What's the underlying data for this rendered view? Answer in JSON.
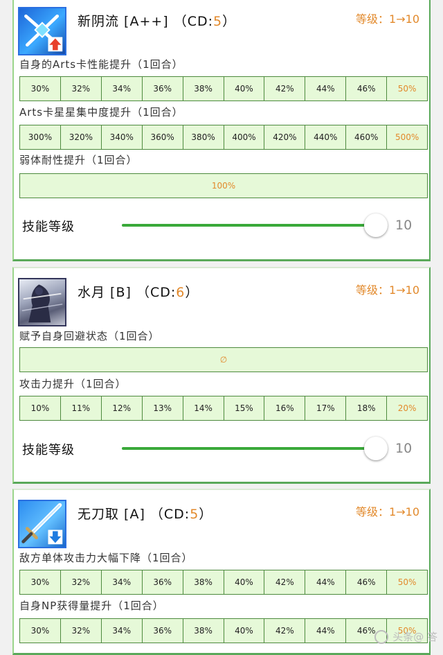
{
  "skills": [
    {
      "icon": "crossed-swords-buff-icon",
      "name": "新阴流 [A++] （CD:",
      "cd": "5",
      "cd_close": "）",
      "level_range": "等级：1→10",
      "effects": [
        {
          "label": "自身的Arts卡性能提升（1回合）",
          "values": [
            "30%",
            "32%",
            "34%",
            "36%",
            "38%",
            "40%",
            "42%",
            "44%",
            "46%",
            "50%"
          ]
        },
        {
          "label": "Arts卡星星集中度提升（1回合）",
          "values": [
            "300%",
            "320%",
            "340%",
            "360%",
            "380%",
            "400%",
            "420%",
            "440%",
            "460%",
            "500%"
          ]
        },
        {
          "label": "弱体耐性提升（1回合）",
          "single": "100%"
        }
      ],
      "level_label": "技能等级",
      "level_value": "10",
      "level_fraction": 1.0
    },
    {
      "icon": "samurai-portrait-icon",
      "name": "水月 [B] （CD:",
      "cd": "6",
      "cd_close": "）",
      "level_range": "等级：1→10",
      "effects": [
        {
          "label": "赋予自身回避状态（1回合）",
          "single": "∅"
        },
        {
          "label": "攻击力提升（1回合）",
          "values": [
            "10%",
            "11%",
            "12%",
            "13%",
            "14%",
            "15%",
            "16%",
            "17%",
            "18%",
            "20%"
          ]
        }
      ],
      "level_label": "技能等级",
      "level_value": "10",
      "level_fraction": 1.0
    },
    {
      "icon": "sword-debuff-icon",
      "name": "无刀取 [A] （CD:",
      "cd": "5",
      "cd_close": "）",
      "level_range": "等级：1→10",
      "effects": [
        {
          "label": "敌方单体攻击力大幅下降（1回合）",
          "values": [
            "30%",
            "32%",
            "34%",
            "36%",
            "38%",
            "40%",
            "42%",
            "44%",
            "46%",
            "50%"
          ]
        },
        {
          "label": "自身NP获得量提升（1回合）",
          "values": [
            "30%",
            "32%",
            "34%",
            "36%",
            "38%",
            "40%",
            "42%",
            "44%",
            "46%",
            "50%"
          ]
        }
      ]
    }
  ],
  "watermark": "头条@ 答",
  "colors": {
    "accent": "#e2892b",
    "cell_bg": "#e6f9d8",
    "cell_border": "#4d8a3e",
    "slider": "#3aa93a",
    "card_border": "#5aa95a"
  }
}
